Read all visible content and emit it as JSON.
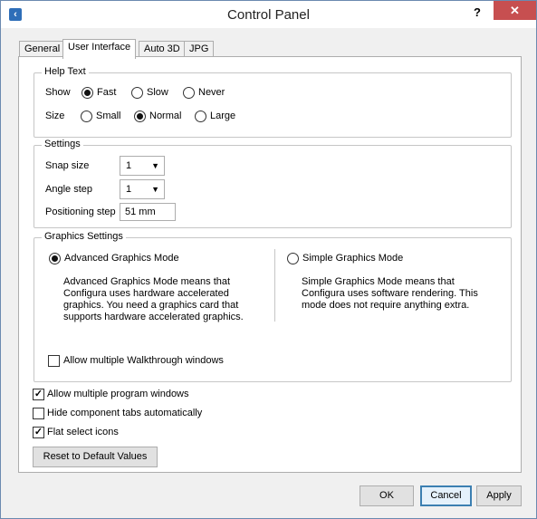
{
  "window": {
    "title": "Control Panel",
    "help_label": "?",
    "close_label": "✕",
    "app_icon": "app-icon"
  },
  "tabs": [
    {
      "label": "General"
    },
    {
      "label": "User Interface"
    },
    {
      "label": "Auto 3D"
    },
    {
      "label": "JPG"
    }
  ],
  "help_text": {
    "legend": "Help Text",
    "show_label": "Show",
    "show_options": [
      "Fast",
      "Slow",
      "Never"
    ],
    "show_selected": "Fast",
    "size_label": "Size",
    "size_options": [
      "Small",
      "Normal",
      "Large"
    ],
    "size_selected": "Normal"
  },
  "settings": {
    "legend": "Settings",
    "snap_label": "Snap size",
    "snap_value": "1",
    "angle_label": "Angle step",
    "angle_value": "1",
    "pos_label": "Positioning step",
    "pos_value": "51 mm"
  },
  "graphics": {
    "legend": "Graphics Settings",
    "advanced_label": "Advanced Graphics Mode",
    "advanced_desc": [
      "Advanced Graphics Mode means that",
      "Configura uses hardware accelerated",
      "graphics. You need a graphics card that",
      "supports hardware accelerated graphics."
    ],
    "simple_label": "Simple Graphics Mode",
    "simple_desc": [
      "Simple Graphics Mode means that",
      "Configura uses software rendering. This",
      "mode does not require anything extra."
    ],
    "selected": "Advanced Graphics Mode",
    "walkthrough_label": "Allow multiple Walkthrough windows",
    "walkthrough_checked": false
  },
  "options": {
    "multi_program_label": "Allow multiple program windows",
    "multi_program_checked": true,
    "hide_tabs_label": "Hide component tabs automatically",
    "hide_tabs_checked": false,
    "flat_icons_label": "Flat select icons",
    "flat_icons_checked": true
  },
  "reset_label": "Reset to Default Values",
  "footer": {
    "ok": "OK",
    "cancel": "Cancel",
    "apply": "Apply"
  }
}
